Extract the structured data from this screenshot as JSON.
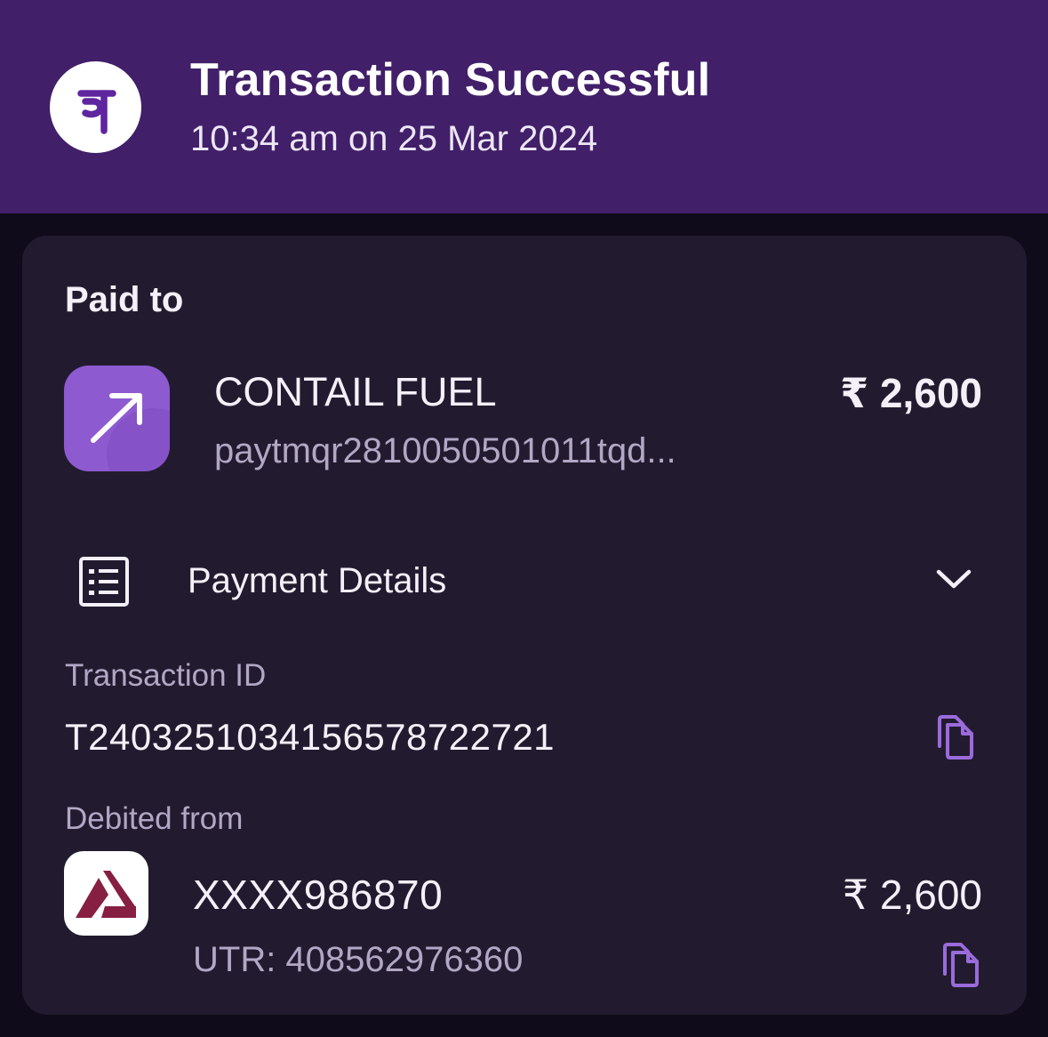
{
  "header": {
    "title": "Transaction Successful",
    "datetime": "10:34 am on 25 Mar 2024",
    "logo_icon": "phonepe-logo",
    "background_color": "#411f69"
  },
  "paid_to": {
    "label": "Paid to",
    "merchant_name": "CONTAIL FUEL",
    "merchant_upi": "paytmqr2810050501011tqd...",
    "amount": "₹ 2,600",
    "avatar_icon": "arrow-up-right-icon",
    "avatar_color": "#8e5ad0"
  },
  "payment_details": {
    "label": "Payment Details",
    "icon": "receipt-list-icon",
    "expand_icon": "chevron-down-icon",
    "transaction_id_label": "Transaction ID",
    "transaction_id": "T2403251034156578722721",
    "copy_icon": "copy-icon",
    "debited_from_label": "Debited from",
    "account_number": "XXXX986870",
    "debit_amount": "₹ 2,600",
    "utr": "UTR: 408562976360",
    "bank_icon": "axis-bank-logo"
  },
  "colors": {
    "page_background": "#0f0b1a",
    "card_background": "#221b2f",
    "accent_purple": "#9b6bdc",
    "secondary_text": "#b2a7c4"
  }
}
